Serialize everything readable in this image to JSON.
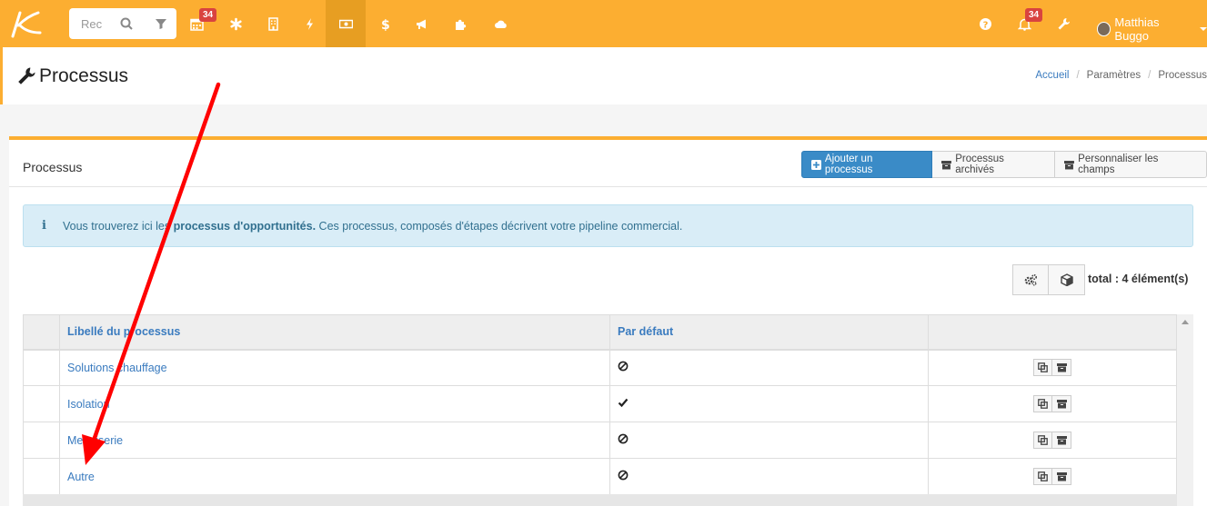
{
  "nav": {
    "search_placeholder": "Rec",
    "badge_calendar": "34",
    "badge_notifications": "34",
    "user_name": "Matthias Buggo"
  },
  "page": {
    "title": "Processus",
    "breadcrumb": [
      "Accueil",
      "Paramètres",
      "Processus"
    ]
  },
  "box": {
    "title": "Processus",
    "buttons": {
      "add": "Ajouter un processus",
      "archived": "Processus archivés",
      "customize": "Personnaliser les champs"
    },
    "alert": {
      "before": "Vous trouverez ici les ",
      "bold": "processus d'opportunités.",
      "after": " Ces processus, composés d'étapes décrivent votre pipeline commercial."
    },
    "total": "total : 4 élément(s)"
  },
  "table": {
    "headers": [
      "Libellé du processus",
      "Par défaut"
    ],
    "rows": [
      {
        "label": "Solutions chauffage",
        "default": "non"
      },
      {
        "label": "Isolation",
        "default": "oui"
      },
      {
        "label": "Menuiserie",
        "default": "non"
      },
      {
        "label": "Autre",
        "default": "non"
      }
    ]
  },
  "colors": {
    "accent": "#fcae31",
    "primary": "#3a8bc7",
    "arrow": "#ff0000"
  }
}
